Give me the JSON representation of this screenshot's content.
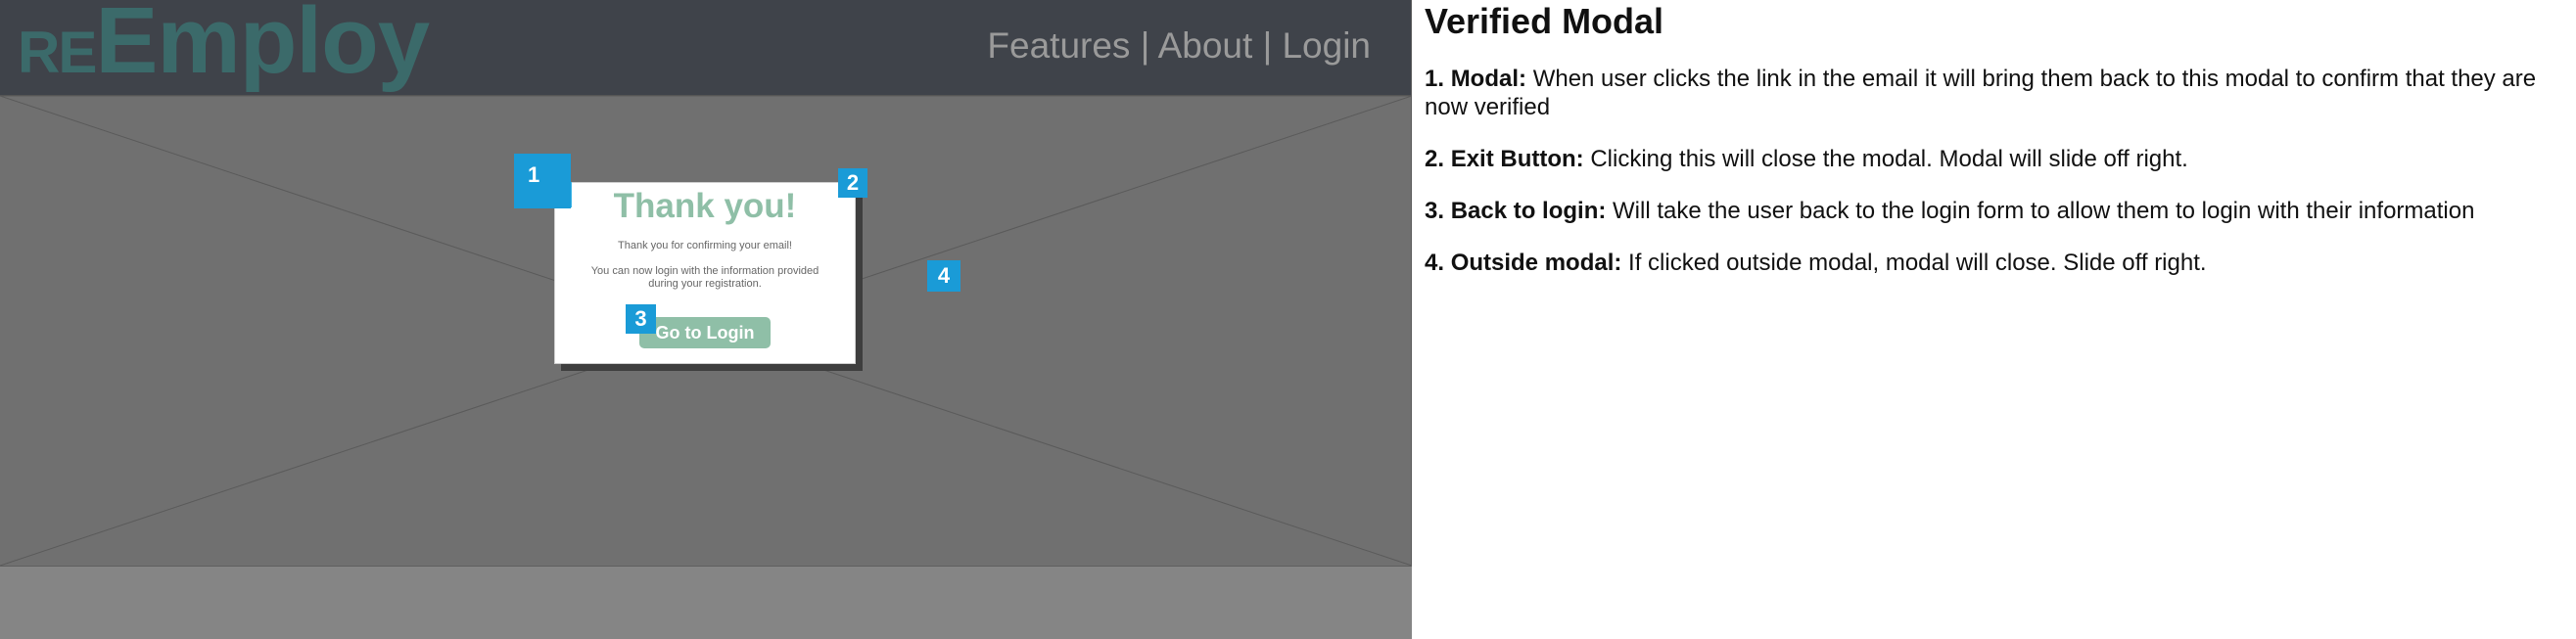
{
  "header": {
    "logo_prefix": "RE",
    "logo_main": "Employ",
    "nav": [
      "Features",
      "About",
      "Login"
    ],
    "nav_separator": "|"
  },
  "modal": {
    "title": "Thank you!",
    "line1": "Thank you for confirming your email!",
    "line2": "You can now login with the information provided during your registration.",
    "button_label": "Go to Login"
  },
  "markers": [
    "1",
    "2",
    "3",
    "4"
  ],
  "panel": {
    "title": "Verified Modal",
    "notes": [
      {
        "number": "1.",
        "label": "Modal:",
        "text": "When user clicks the link in the email it will bring them back to this modal to confirm that they are now verified"
      },
      {
        "number": "2.",
        "label": "Exit Button:",
        "text": "Clicking this will close the modal. Modal will slide off right."
      },
      {
        "number": "3.",
        "label": "Back to login:",
        "text": "Will take the user back to the login form to allow them to login with their information"
      },
      {
        "number": "4.",
        "label": "Outside modal:",
        "text": "If clicked outside modal, modal will close. Slide off right."
      }
    ]
  },
  "colors": {
    "accent_green": "#8fbfa7",
    "marker_blue": "#1a9bd7",
    "logo_teal": "#3b6a6a",
    "header_bg": "#3f434a"
  }
}
